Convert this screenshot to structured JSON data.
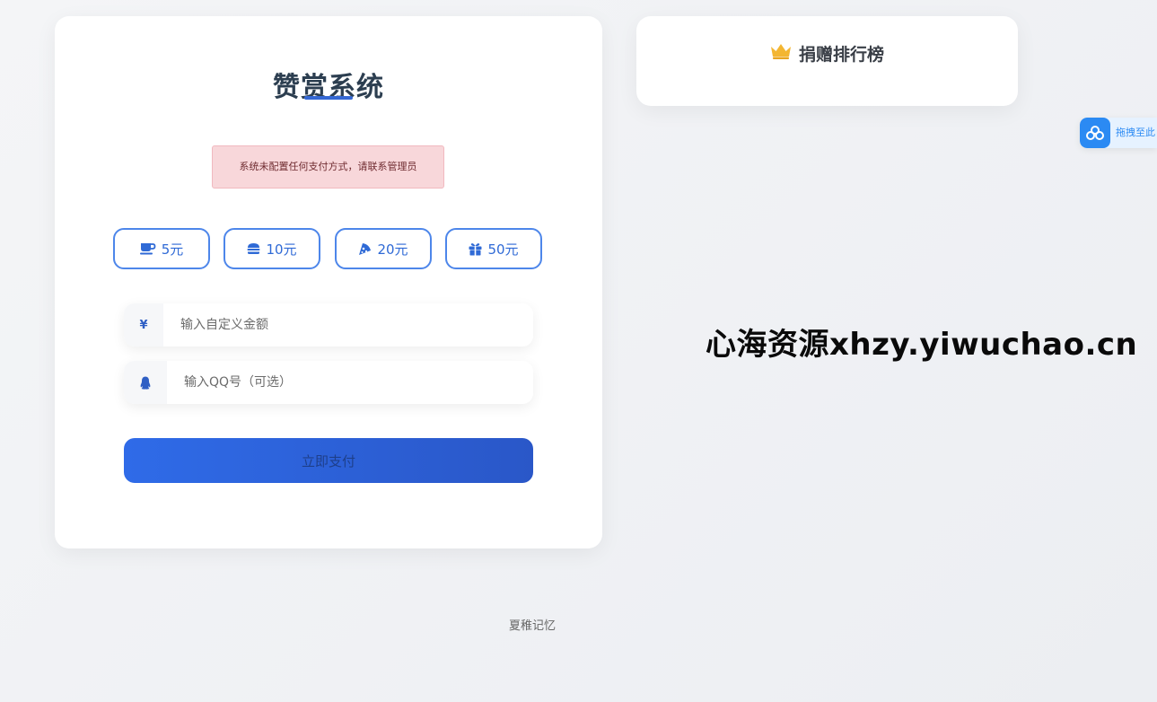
{
  "pay_card": {
    "title": "赞赏系统",
    "alert": "系统未配置任何支付方式，请联系管理员",
    "amounts": [
      {
        "label": "5元",
        "icon": "coffee-icon"
      },
      {
        "label": "10元",
        "icon": "burger-icon"
      },
      {
        "label": "20元",
        "icon": "pizza-icon"
      },
      {
        "label": "50元",
        "icon": "gift-icon"
      }
    ],
    "amount_input": {
      "prefix": "¥",
      "placeholder": "输入自定义金额"
    },
    "qq_input": {
      "prefix_icon": "qq-icon",
      "placeholder": "输入QQ号（可选）"
    },
    "submit_label": "立即支付"
  },
  "rank_card": {
    "icon": "crown-icon",
    "title": "捐赠排行榜"
  },
  "watermark": "心海资源xhzy.yiwuchao.cn",
  "footer": "夏稚记忆",
  "side_widget": {
    "icon": "baidu-netdisk-icon",
    "label": "拖拽至此"
  },
  "colors": {
    "accent": "#3568d4",
    "button_border": "#4d86ea",
    "alert_bg": "#f8d7da",
    "crown": "#f3b632",
    "side_widget": "#2b8af3"
  }
}
